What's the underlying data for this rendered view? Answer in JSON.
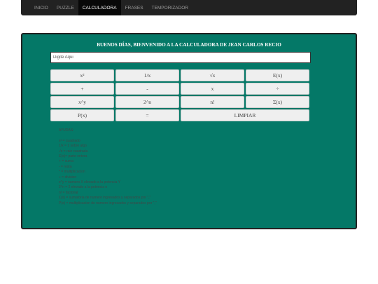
{
  "nav": {
    "items": [
      {
        "label": "INICIO"
      },
      {
        "label": "PUZZLE"
      },
      {
        "label": "CALCULADORA"
      },
      {
        "label": "FRASES"
      },
      {
        "label": "TEMPORIZADOR"
      }
    ],
    "active_index": 2
  },
  "calculator": {
    "greeting": "BUENOS DÍAS, BIENVENIDO A LA CALCULADORA DE JEAN CARLOS RECIO",
    "input_placeholder": "Digite Aqui",
    "keys": [
      {
        "label": "x²"
      },
      {
        "label": "1/x"
      },
      {
        "label": "√x"
      },
      {
        "label": "E(x)"
      },
      {
        "label": "+"
      },
      {
        "label": "-"
      },
      {
        "label": "x"
      },
      {
        "label": "÷"
      },
      {
        "label": "x^y"
      },
      {
        "label": "2^n"
      },
      {
        "label": "n!"
      },
      {
        "label": "Σ(x)"
      },
      {
        "label": "P(x)"
      },
      {
        "label": "="
      },
      {
        "label": "LIMPIAR"
      }
    ]
  },
  "help": {
    "title": "AYUDAS:",
    "lines": [
      "x² = cuadrado",
      "1/x = 1 sobre algo",
      "√x = raiz cuadrada",
      "E(x)= parte entera",
      "+ = suma",
      "- = resta",
      "* = multiplicacion",
      "÷ = division",
      "x^y = numero X elevado a la potencia Y",
      "2^n = 2 elevado a la potencia n",
      "n! = factorial",
      "Σ(x) = sumatoria de numero ingresados y separados por \",\"",
      "P(x) = multiplicacion de numero ingresados y separados por \",\""
    ]
  },
  "colors": {
    "navbar": "#222222",
    "panel": "#047867",
    "key": "#efefef"
  }
}
